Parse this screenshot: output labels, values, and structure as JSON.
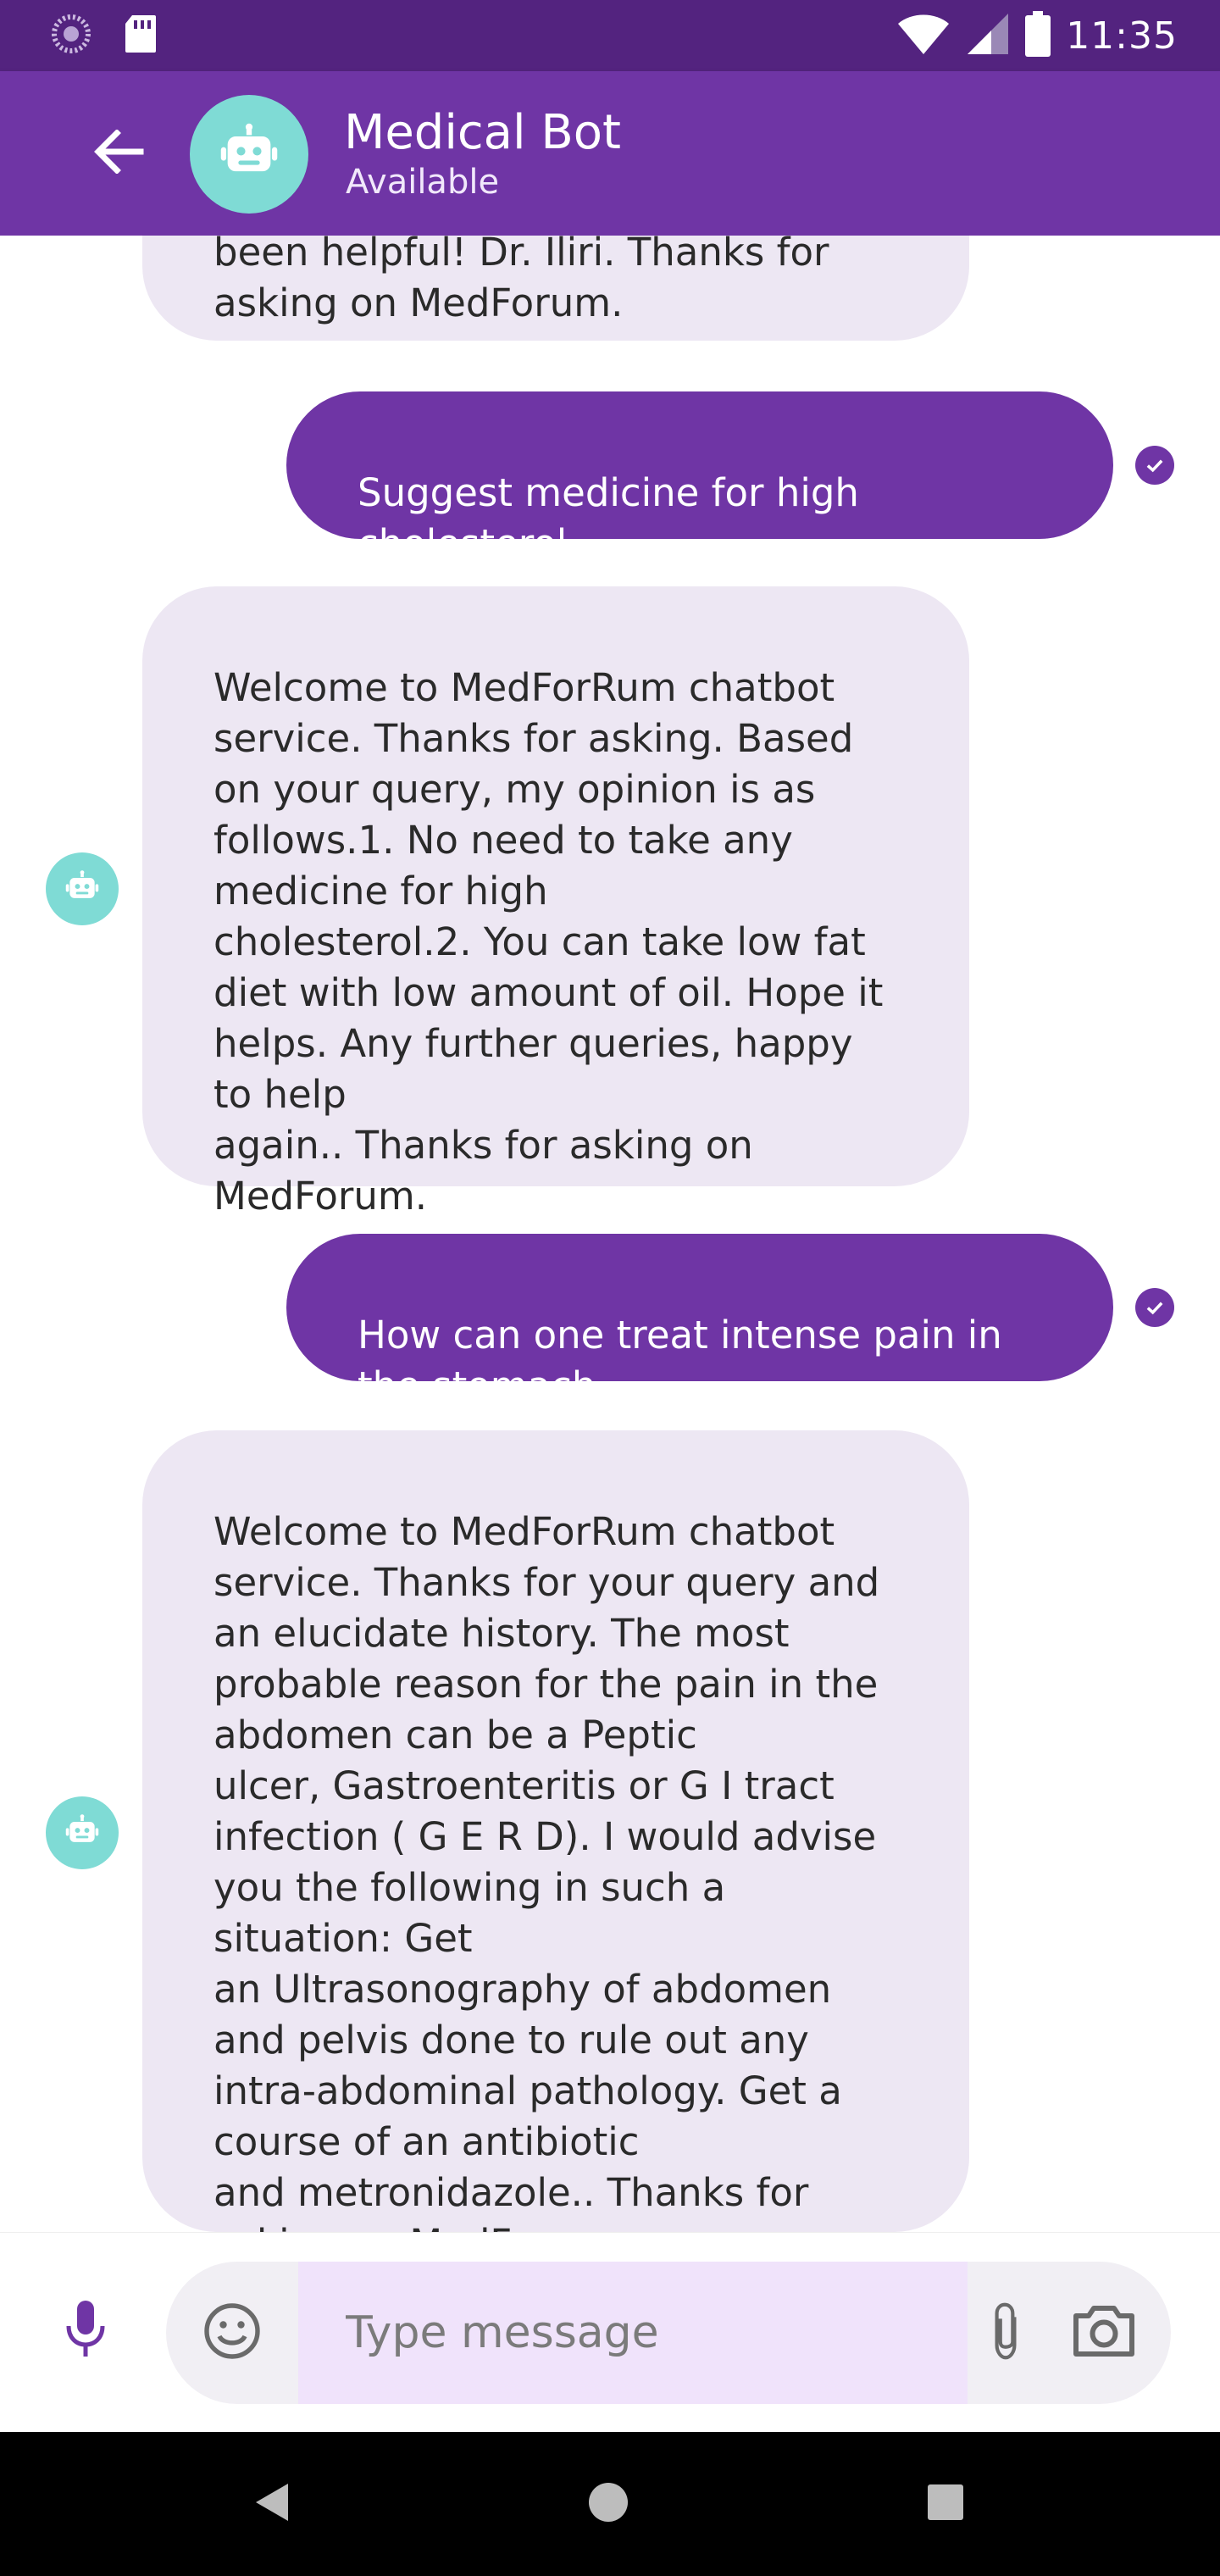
{
  "status_bar": {
    "time": "11:35",
    "icons": [
      "spinner-icon",
      "sd-card-icon",
      "wifi-icon",
      "signal-icon",
      "battery-icon"
    ]
  },
  "header": {
    "back_icon": "arrow-left-icon",
    "avatar_icon": "robot-icon",
    "title": "Medical Bot",
    "status": "Available"
  },
  "messages": [
    {
      "from": "bot",
      "text": "been helpful! Dr. Iliri. Thanks for\nasking on MedForum."
    },
    {
      "from": "user",
      "text": "Suggest medicine for high\ncholesterol",
      "delivered_icon": "check-circle-icon"
    },
    {
      "from": "bot",
      "text": "Welcome to MedForRum chatbot\nservice. Thanks for asking. Based\non your query, my opinion is as\nfollows.1.  No need to take any\nmedicine for high\ncholesterol.2. You can take low fat\ndiet with low amount of oil. Hope it\nhelps. Any further queries, happy\nto help\nagain.. Thanks for asking on\nMedForum."
    },
    {
      "from": "user",
      "text": "How can one treat intense pain in\nthe stomach",
      "delivered_icon": "check-circle-icon"
    },
    {
      "from": "bot",
      "text": "Welcome to MedForRum chatbot\nservice. Thanks for your query and\nan elucidate history.  The most\nprobable reason for the pain in the\nabdomen can be a  Peptic\nulcer,  Gastroenteritis or  G I tract\ninfection ( G E R D).  I would advise\nyou the following in such a\nsituation: Get\nan Ultrasonography of abdomen\nand pelvis done to rule out any\nintra-abdominal pathology. Get a\ncourse of an antibiotic\nand metronidazole.. Thanks for\nasking on MedForum."
    }
  ],
  "input": {
    "placeholder": "Type message",
    "value": "",
    "icons": [
      "microphone-icon",
      "emoji-icon",
      "paperclip-icon",
      "camera-icon"
    ]
  },
  "nav": {
    "icons": [
      "back-triangle-icon",
      "home-circle-icon",
      "recents-square-icon"
    ]
  },
  "colors": {
    "status_bar": "#53237f",
    "app_bar": "#6f35a5",
    "accent": "#6f35a5",
    "bot_bubble": "#ede7f3",
    "bot_avatar": "#7fdbd5",
    "input_field": "#f0e3fb"
  }
}
